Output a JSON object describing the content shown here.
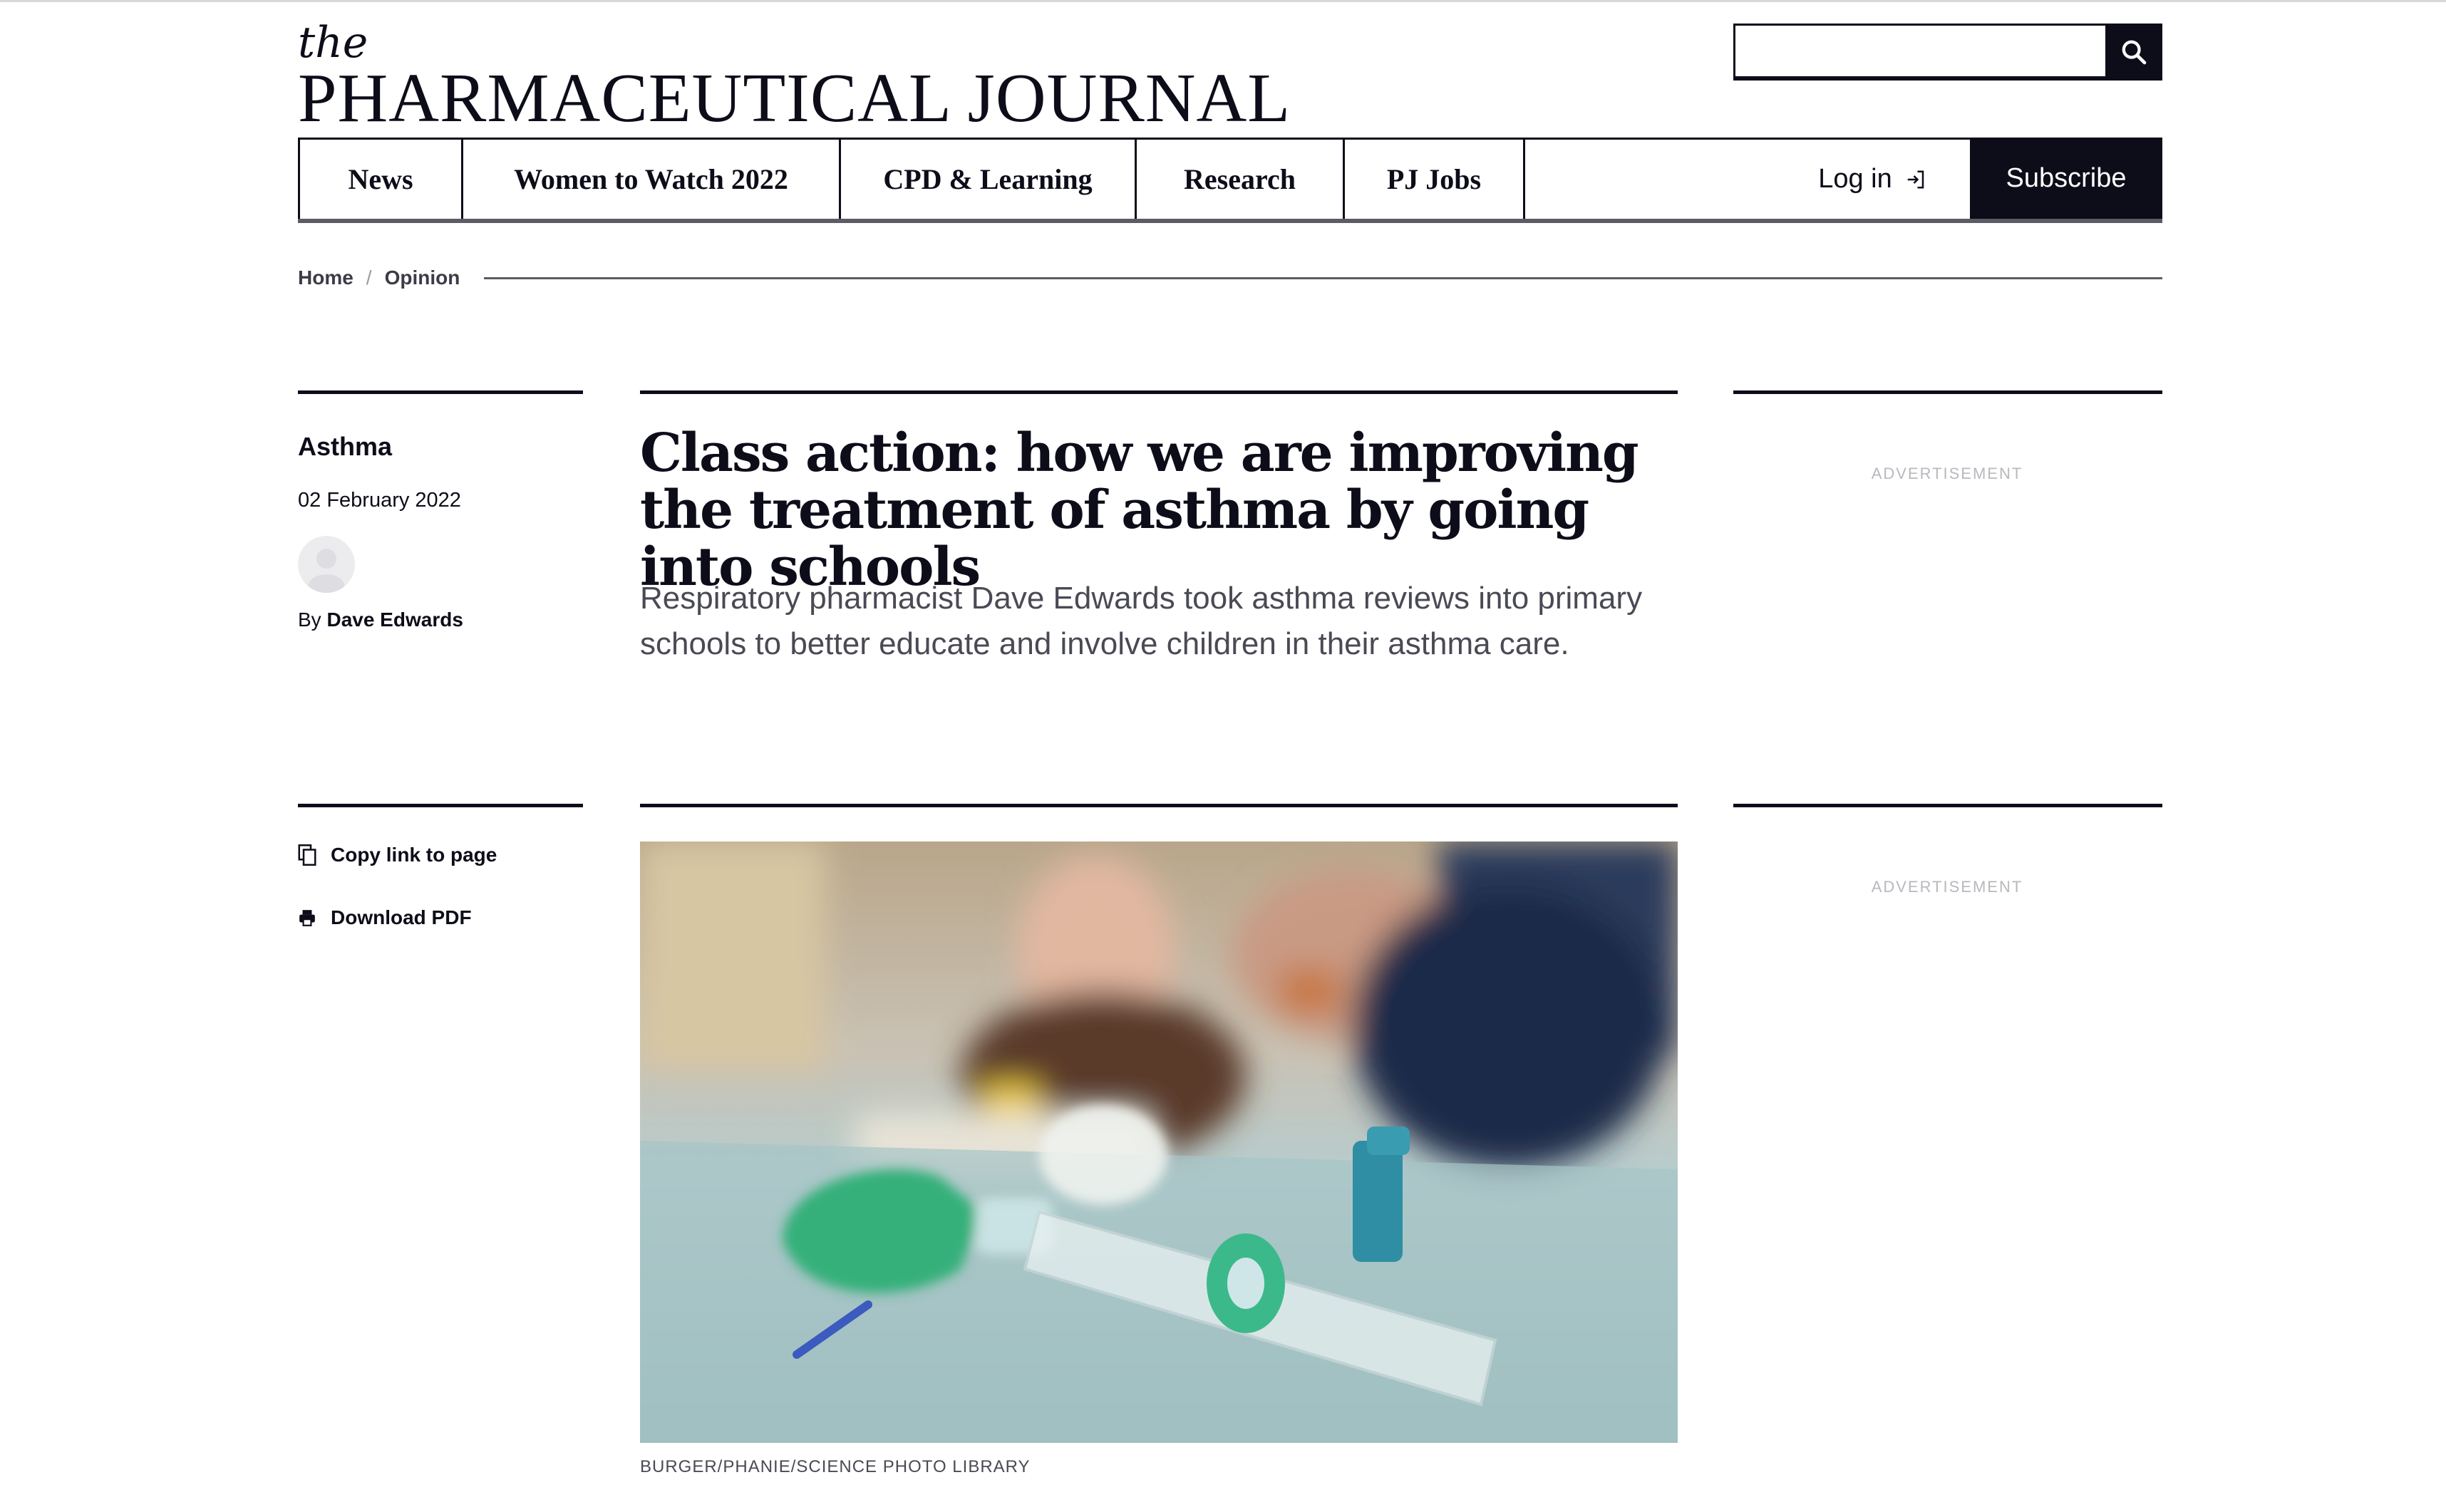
{
  "logo": {
    "the": "the",
    "title": "PHARMACEUTICAL JOURNAL"
  },
  "search": {
    "placeholder": "",
    "icon": "search-icon"
  },
  "nav": {
    "items": [
      {
        "label": "News"
      },
      {
        "label": "Women to Watch 2022"
      },
      {
        "label": "CPD & Learning"
      },
      {
        "label": "Research"
      },
      {
        "label": "PJ Jobs"
      }
    ],
    "login_label": "Log in",
    "subscribe_label": "Subscribe"
  },
  "breadcrumb": {
    "home": "Home",
    "separator": "/",
    "current": "Opinion"
  },
  "article": {
    "topic": "Asthma",
    "date": "02 February 2022",
    "by_prefix": "By",
    "author": "Dave Edwards",
    "headline": "Class action: how we are improving the treatment of asthma by going into schools",
    "standfirst": "Respiratory pharmacist Dave Edwards took asthma reviews into primary schools to better educate and involve children in their asthma care.",
    "image_caption": "BURGER/PHANIE/SCIENCE PHOTO LIBRARY"
  },
  "ads": {
    "label_1": "ADVERTISEMENT",
    "label_2": "ADVERTISEMENT"
  },
  "tools": {
    "copy_link": "Copy link to page",
    "download_pdf": "Download PDF"
  },
  "colors": {
    "ink": "#0d0d1a",
    "muted": "#4a4a55",
    "ad_label": "#b8b8be"
  }
}
